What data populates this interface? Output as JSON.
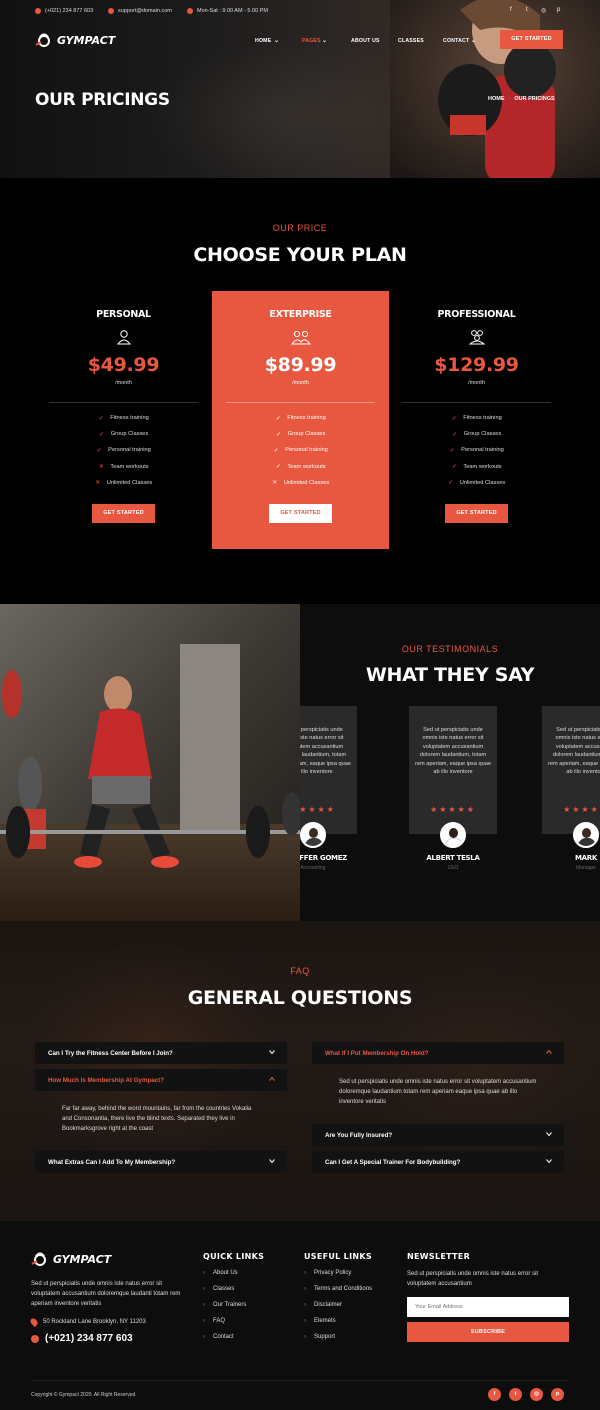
{
  "topbar": {
    "phone": "(+021) 234 877 603",
    "email": "support@domain.com",
    "hours": "Mon-Sat : 9.00 AM - 5.00 PM",
    "social": [
      "f",
      "t",
      "ig",
      "p"
    ]
  },
  "brand": {
    "name": "GYMPACT"
  },
  "nav": {
    "items": [
      "HOME",
      "PAGES",
      "ABOUT US",
      "CLASSES",
      "CONTACT"
    ],
    "active": "PAGES",
    "cta": "GET STARTED"
  },
  "hero": {
    "title": "OUR PRICINGS",
    "breadcrumb": [
      "HOME",
      "OUR PRICINGS"
    ]
  },
  "pricing": {
    "kicker": "OUR PRICE",
    "title": "CHOOSE YOUR PLAN",
    "plans": [
      {
        "name": "PERSONAL",
        "icon": "person-icon",
        "price": "$49.99",
        "period": "/month",
        "features": [
          {
            "label": "Fitness training",
            "included": true
          },
          {
            "label": "Group Classes",
            "included": true
          },
          {
            "label": "Personal training",
            "included": true
          },
          {
            "label": "Team workouts",
            "included": false
          },
          {
            "label": "Unlimited Classes",
            "included": false
          }
        ],
        "button": "GET STARTED"
      },
      {
        "name": "EXTERPRISE",
        "icon": "group-icon",
        "price": "$89.99",
        "period": "/month",
        "features": [
          {
            "label": "Fitness training",
            "included": true
          },
          {
            "label": "Group Classes",
            "included": true
          },
          {
            "label": "Personal training",
            "included": true
          },
          {
            "label": "Team workouts",
            "included": true
          },
          {
            "label": "Unlimited Classes",
            "included": false
          }
        ],
        "button": "GET STARTED"
      },
      {
        "name": "PROFESSIONAL",
        "icon": "team-icon",
        "price": "$129.99",
        "period": "/month",
        "features": [
          {
            "label": "Fitness training",
            "included": true
          },
          {
            "label": "Group Classes",
            "included": true
          },
          {
            "label": "Personal training",
            "included": true
          },
          {
            "label": "Team workouts",
            "included": true
          },
          {
            "label": "Unlimited Classes",
            "included": true
          }
        ],
        "button": "GET STARTED"
      }
    ]
  },
  "testimonials": {
    "kicker": "OUR TESTIMONIALS",
    "title": "WHAT THEY SAY",
    "cards": [
      {
        "text": "Sed ut perspiciatis unde omnis iste natus error sit voluptatem accusantium dolorem laudantium, totam rem aperiam, eaque ipsa quae ab illo inventore",
        "name": "JENNIFFER GOMEZ",
        "role": "Accounting",
        "stars": 5
      },
      {
        "text": "Sed ut perspiciatis unde omnis iste natus error sit voluptatem accusantium dolorem laudantium, totam rem aperiam, eaque ipsa quae ab illo inventore",
        "name": "ALBERT TESLA",
        "role": "CEO",
        "stars": 5
      },
      {
        "text": "Sed ut perspiciatis unde omnis iste natus error sit voluptatem accusantium dolorem laudantium, totam rem aperiam, eaque ipsa quae ab illo inventore",
        "name": "MARK",
        "role": "Manager",
        "stars": 5
      }
    ]
  },
  "faq": {
    "kicker": "FAQ",
    "title": "GENERAL QUESTIONS",
    "left": [
      {
        "q": "Can I Try the Fitness Center Before I Join?",
        "open": false
      },
      {
        "q": "How Much Is Membership At Gympact?",
        "open": true,
        "a": "Far far away, behind the word mountains, far from the countries Vokalia and Consonantia, there live the blind texts. Separated they live in Bookmarksgrove right at the coast"
      },
      {
        "q": "What Extras Can I Add To My Membership?",
        "open": false
      }
    ],
    "right": [
      {
        "q": "What If I Put Membership On Hold?",
        "open": true,
        "a": "Sed ut perspiciatis unde omnis iste natus error sit voluptatem accusantium doloremque laudantium totam rem aperiam eaque ipsa quae ab illo inventore veritatis"
      },
      {
        "q": "Are You Fully Insured?",
        "open": false
      },
      {
        "q": "Can I Get A Special Trainer For Bodybuilding?",
        "open": false
      }
    ]
  },
  "footer": {
    "about": "Sed ut perspiciatis unde omnis iste natus error sit voluptatem accusantium doloremque laudanti totam rem aperiam inventore veritatis",
    "address": "50 Rockland Lane Brooklyn, NY 11203",
    "phone": "(+021) 234 877 603",
    "quick_links": {
      "title": "QUICK LINKS",
      "items": [
        "About Us",
        "Classes",
        "Our Trainers",
        "FAQ",
        "Contact"
      ]
    },
    "useful_links": {
      "title": "USEFUL LINKS",
      "items": [
        "Privacy Policy",
        "Terms and Conditions",
        "Disclaimer",
        "Elemets",
        "Support"
      ]
    },
    "newsletter": {
      "title": "NEWSLETTER",
      "text": "Sed ut perspiciatis unde omnis iste natus error sit voluptatem accusantium",
      "placeholder": "Your Email Address",
      "button": "SUBSCRIBE"
    },
    "copyright": "Copyright © Gympact 2020. All Right Reserved.",
    "social": [
      "f",
      "t",
      "ig",
      "p"
    ]
  },
  "colors": {
    "accent": "#e8573f",
    "background": "#000000",
    "card": "#2a2a2a"
  }
}
